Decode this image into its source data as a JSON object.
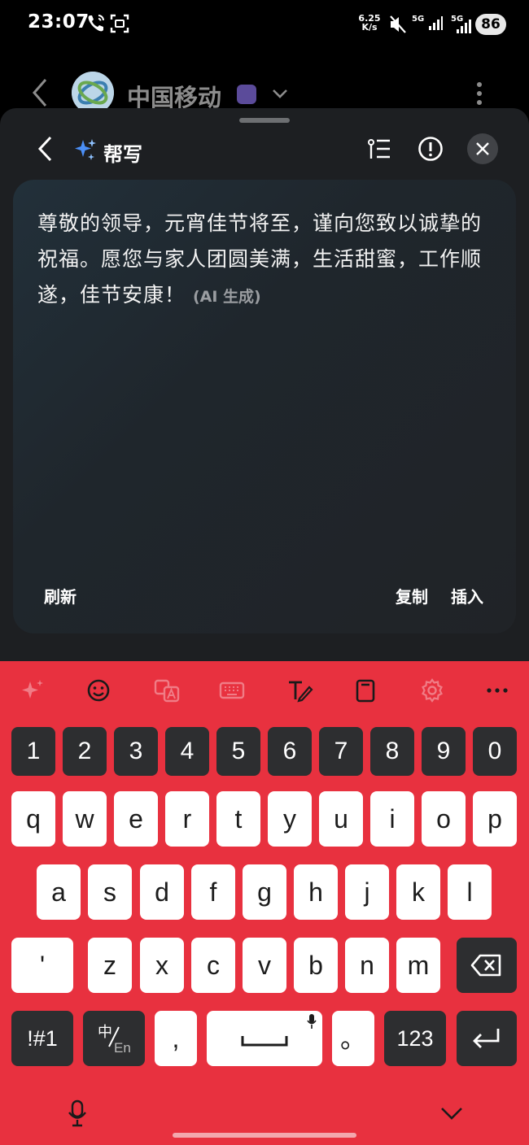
{
  "status_bar": {
    "time": "23:07",
    "speed_value": "6.25",
    "speed_unit": "K/s",
    "net_1": "5G",
    "net_2": "5G",
    "battery": "86"
  },
  "chat_header": {
    "title": "中国移动"
  },
  "sheet": {
    "title": "帮写",
    "generated_text": "尊敬的领导，元宵佳节将至，谨向您致以诚挚的祝福。愿您与家人团圆美满，生活甜蜜，工作顺遂，佳节安康！",
    "ai_tag": "(AI 生成)",
    "refresh_label": "刷新",
    "copy_label": "复制",
    "insert_label": "插入"
  },
  "keyboard": {
    "row_numbers": [
      "1",
      "2",
      "3",
      "4",
      "5",
      "6",
      "7",
      "8",
      "9",
      "0"
    ],
    "row_1": [
      "q",
      "w",
      "e",
      "r",
      "t",
      "y",
      "u",
      "i",
      "o",
      "p"
    ],
    "row_2": [
      "a",
      "s",
      "d",
      "f",
      "g",
      "h",
      "j",
      "k",
      "l"
    ],
    "row_3": [
      "'",
      "z",
      "x",
      "c",
      "v",
      "b",
      "n",
      "m"
    ],
    "symbols_label": "!#1",
    "lang_zh": "中",
    "lang_en": "En",
    "comma": ",",
    "period": "。",
    "numbers_label": "123"
  },
  "colors": {
    "keyboard_bg": "#e8313f",
    "sheet_bg": "#1d1f22",
    "accent_sparkle": "#4b8ff7"
  }
}
